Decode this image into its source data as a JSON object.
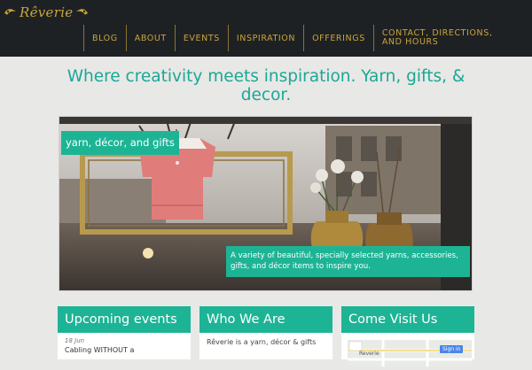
{
  "brand": {
    "name": "Rêverie"
  },
  "nav": [
    {
      "label": "BLOG"
    },
    {
      "label": "ABOUT"
    },
    {
      "label": "EVENTS"
    },
    {
      "label": "INSPIRATION"
    },
    {
      "label": "OFFERINGS"
    },
    {
      "label": "CONTACT, DIRECTIONS, AND HOURS"
    }
  ],
  "tagline": "Where creativity meets inspiration. Yarn, gifts, & decor.",
  "hero": {
    "caption": "yarn, décor, and gifts",
    "description": "A variety of beautiful, specially selected yarns, accessories, gifts, and décor items to inspire you."
  },
  "panels": {
    "events": {
      "title": "Upcoming events",
      "date": "18 Jun",
      "event_title": "Cabling WITHOUT a"
    },
    "who": {
      "title": "Who We Are",
      "text": "Rêverie is a yarn, décor & gifts"
    },
    "visit": {
      "title": "Come Visit Us",
      "map_button": "Sign in",
      "map_label": "Reverie"
    }
  },
  "colors": {
    "header_bg": "#1e2124",
    "gold": "#c9a53a",
    "teal": "#1db495",
    "tagline": "#1aa895",
    "page_bg": "#e8e8e6"
  }
}
